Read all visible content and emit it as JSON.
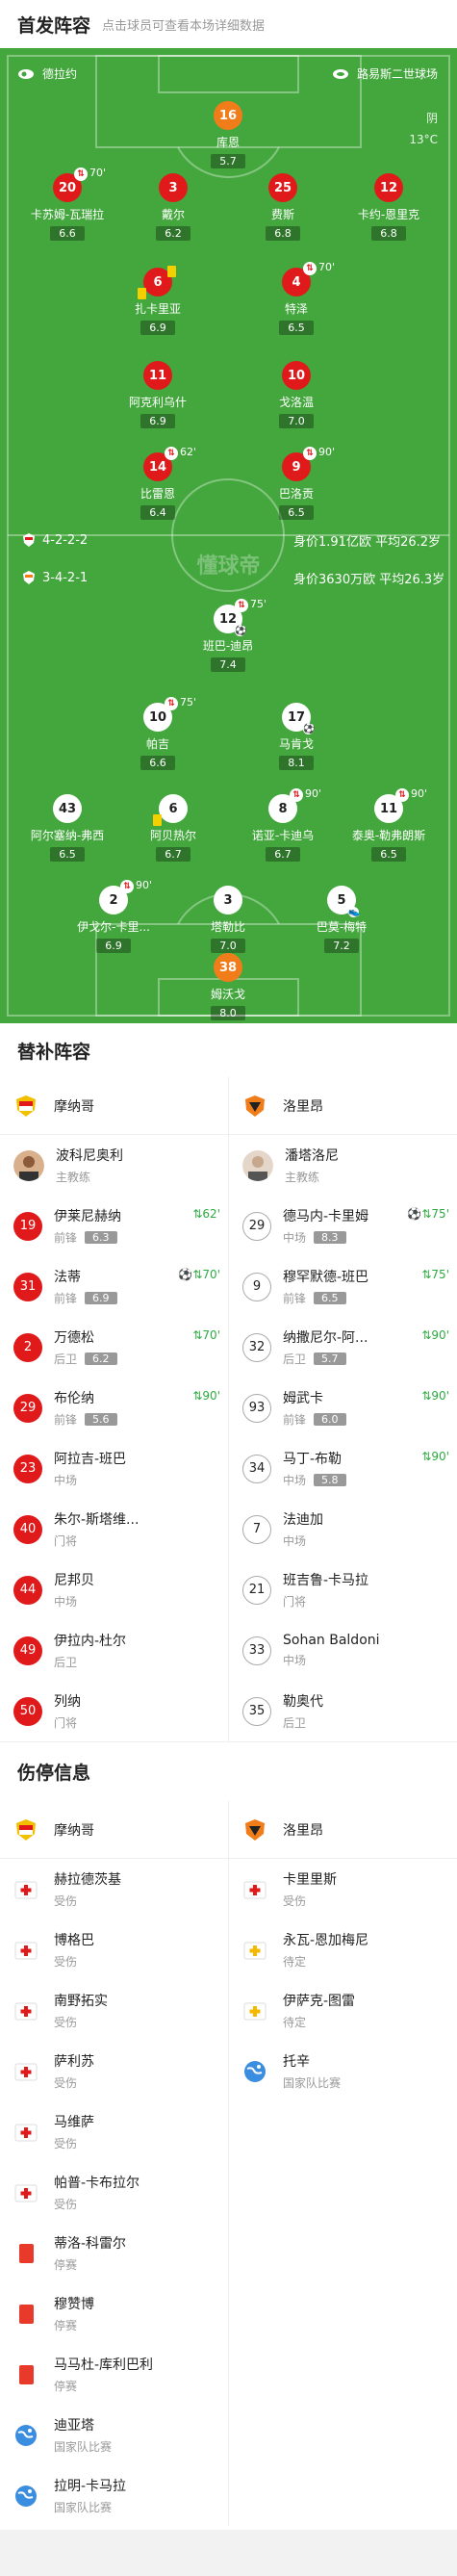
{
  "header": {
    "title": "首发阵容",
    "subtitle": "点击球员可查看本场详细数据"
  },
  "pitch_top": {
    "coach_home": "德拉约",
    "venue": "路易斯二世球场",
    "weather": "阴",
    "temp": "13°C",
    "watermark": "懂球帝"
  },
  "lineup_info": {
    "home": {
      "formation": "4-2-2-2",
      "value": "身价1.91亿欧",
      "age": "平均26.2岁"
    },
    "away": {
      "formation": "3-4-2-1",
      "value": "身价3630万欧",
      "age": "平均26.3岁"
    }
  },
  "home_players": [
    {
      "num": "16",
      "name": "库恩",
      "score": "5.7"
    },
    {
      "num": "20",
      "name": "卡苏姆-瓦瑞拉",
      "score": "6.6",
      "sub": "70'"
    },
    {
      "num": "3",
      "name": "戴尔",
      "score": "6.2"
    },
    {
      "num": "25",
      "name": "费斯",
      "score": "6.8"
    },
    {
      "num": "12",
      "name": "卡约-恩里克",
      "score": "6.8"
    },
    {
      "num": "6",
      "name": "扎卡里亚",
      "score": "6.9"
    },
    {
      "num": "4",
      "name": "特泽",
      "score": "6.5",
      "sub": "70'"
    },
    {
      "num": "11",
      "name": "阿克利乌什",
      "score": "6.9"
    },
    {
      "num": "10",
      "name": "戈洛温",
      "score": "7.0"
    },
    {
      "num": "14",
      "name": "比雷恩",
      "score": "6.4",
      "sub": "62'"
    },
    {
      "num": "9",
      "name": "巴洛贡",
      "score": "6.5",
      "sub": "90'"
    }
  ],
  "away_players": [
    {
      "num": "12",
      "name": "班巴-迪昂",
      "score": "7.4",
      "sub": "75'"
    },
    {
      "num": "10",
      "name": "帕吉",
      "score": "6.6",
      "sub": "75'"
    },
    {
      "num": "17",
      "name": "马肯戈",
      "score": "8.1"
    },
    {
      "num": "43",
      "name": "阿尔塞纳-弗西",
      "score": "6.5"
    },
    {
      "num": "6",
      "name": "阿贝热尔",
      "score": "6.7"
    },
    {
      "num": "8",
      "name": "诺亚-卡迪乌",
      "score": "6.7",
      "sub": "90'"
    },
    {
      "num": "11",
      "name": "泰奥-勒弗朗斯",
      "score": "6.5",
      "sub": "90'"
    },
    {
      "num": "2",
      "name": "伊戈尔-卡里...",
      "score": "6.9",
      "sub": "90'"
    },
    {
      "num": "3",
      "name": "塔勒比",
      "score": "7.0"
    },
    {
      "num": "5",
      "name": "巴莫-梅特",
      "score": "7.2"
    },
    {
      "num": "38",
      "name": "姆沃戈",
      "score": "8.0"
    }
  ],
  "subs": {
    "title": "替补阵容",
    "home_team": "摩纳哥",
    "away_team": "洛里昂",
    "home_coach": {
      "name": "波科尼奥利",
      "role": "主教练"
    },
    "away_coach": {
      "name": "潘塔洛尼",
      "role": "主教练"
    },
    "home": [
      {
        "num": "19",
        "name": "伊莱尼赫纳",
        "pos": "前锋",
        "rating": "6.3",
        "event": "62'"
      },
      {
        "num": "31",
        "name": "法蒂",
        "pos": "前锋",
        "rating": "6.9",
        "event": "70'"
      },
      {
        "num": "2",
        "name": "万德松",
        "pos": "后卫",
        "rating": "6.2",
        "event": "70'"
      },
      {
        "num": "29",
        "name": "布伦纳",
        "pos": "前锋",
        "rating": "5.6",
        "event": "90'"
      },
      {
        "num": "23",
        "name": "阿拉吉-班巴",
        "pos": "中场",
        "rating": "",
        "event": ""
      },
      {
        "num": "40",
        "name": "朱尔-斯塔维...",
        "pos": "门将",
        "rating": "",
        "event": ""
      },
      {
        "num": "44",
        "name": "尼邦贝",
        "pos": "中场",
        "rating": "",
        "event": ""
      },
      {
        "num": "49",
        "name": "伊拉内-杜尔",
        "pos": "后卫",
        "rating": "",
        "event": ""
      },
      {
        "num": "50",
        "name": "列纳",
        "pos": "门将",
        "rating": "",
        "event": ""
      }
    ],
    "away": [
      {
        "num": "29",
        "name": "德马内-卡里姆",
        "pos": "中场",
        "rating": "8.3",
        "event": "75'"
      },
      {
        "num": "9",
        "name": "穆罕默德-班巴",
        "pos": "前锋",
        "rating": "6.5",
        "event": "75'"
      },
      {
        "num": "32",
        "name": "纳撒尼尔-阿...",
        "pos": "后卫",
        "rating": "5.7",
        "event": "90'"
      },
      {
        "num": "93",
        "name": "姆武卡",
        "pos": "前锋",
        "rating": "6.0",
        "event": "90'"
      },
      {
        "num": "34",
        "name": "马丁-布勒",
        "pos": "中场",
        "rating": "5.8",
        "event": "90'"
      },
      {
        "num": "7",
        "name": "法迪加",
        "pos": "中场",
        "rating": "",
        "event": ""
      },
      {
        "num": "21",
        "name": "班吉鲁-卡马拉",
        "pos": "门将",
        "rating": "",
        "event": ""
      },
      {
        "num": "33",
        "name": "Sohan Baldoni",
        "pos": "中场",
        "rating": "",
        "event": ""
      },
      {
        "num": "35",
        "name": "勒奥代",
        "pos": "后卫",
        "rating": "",
        "event": ""
      }
    ]
  },
  "injury": {
    "title": "伤停信息",
    "home_team": "摩纳哥",
    "away_team": "洛里昂",
    "home": [
      {
        "name": "赫拉德茨基",
        "status": "受伤",
        "type": "injury"
      },
      {
        "name": "博格巴",
        "status": "受伤",
        "type": "injury"
      },
      {
        "name": "南野拓实",
        "status": "受伤",
        "type": "injury"
      },
      {
        "name": "萨利苏",
        "status": "受伤",
        "type": "injury"
      },
      {
        "name": "马维萨",
        "status": "受伤",
        "type": "injury"
      },
      {
        "name": "帕普-卡布拉尔",
        "status": "受伤",
        "type": "injury"
      },
      {
        "name": "蒂洛-科雷尔",
        "status": "停赛",
        "type": "suspend"
      },
      {
        "name": "穆赞博",
        "status": "停赛",
        "type": "suspend"
      },
      {
        "name": "马马杜-库利巴利",
        "status": "停赛",
        "type": "suspend"
      },
      {
        "name": "迪亚塔",
        "status": "国家队比赛",
        "type": "national"
      },
      {
        "name": "拉明-卡马拉",
        "status": "国家队比赛",
        "type": "national"
      }
    ],
    "away": [
      {
        "name": "卡里里斯",
        "status": "受伤",
        "type": "injury"
      },
      {
        "name": "永瓦-恩加梅尼",
        "status": "待定",
        "type": "doubt"
      },
      {
        "name": "伊萨克-图雷",
        "status": "待定",
        "type": "doubt"
      },
      {
        "name": "托辛",
        "status": "国家队比赛",
        "type": "national"
      }
    ]
  },
  "colors": {
    "pitch": "#43a73d",
    "red": "#e01a1a",
    "orange": "#f07d1a",
    "green": "#2eaa41"
  }
}
